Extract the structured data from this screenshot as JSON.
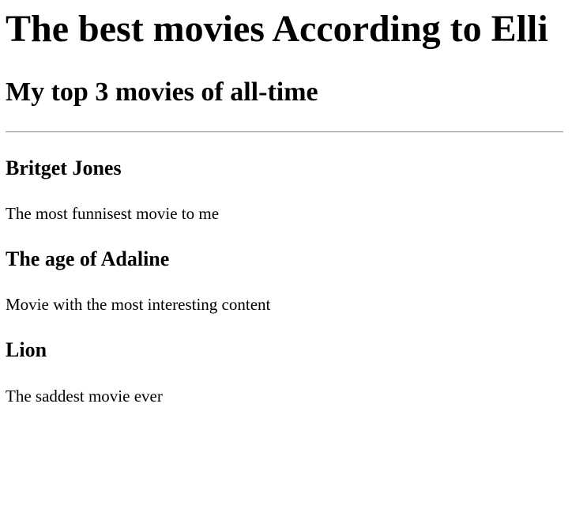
{
  "page": {
    "title": "The best movies According to Elli",
    "subtitle": "My top 3 movies of all-time"
  },
  "movies": [
    {
      "title": "Britget Jones",
      "description": "The most funnisest movie to me"
    },
    {
      "title": "The age of Adaline",
      "description": "Movie with the most interesting content"
    },
    {
      "title": "Lion",
      "description": "The saddest movie ever"
    }
  ]
}
